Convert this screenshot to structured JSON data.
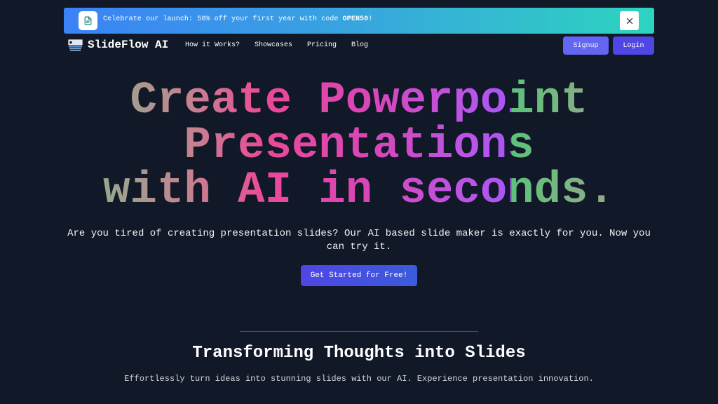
{
  "banner": {
    "text_prefix": "Celebrate our launch: 50% off your first year with code ",
    "code": "OPEN50",
    "text_suffix": "!",
    "icon": "document-icon",
    "close_icon": "close-icon"
  },
  "nav": {
    "brand": "SlideFlow AI",
    "links": [
      "How it Works?",
      "Showcases",
      "Pricing",
      "Blog"
    ],
    "signup": "Signup",
    "login": "Login"
  },
  "hero": {
    "title_line1": "Create Powerpoint",
    "title_line2": "Presentations",
    "title_line3": "with AI in seconds.",
    "subtitle": "Are you tired of creating presentation slides? Our AI based slide maker is exactly for you. Now you can try it.",
    "cta": "Get Started for Free!"
  },
  "section": {
    "title": "Transforming Thoughts into Slides",
    "subtitle": "Effortlessly turn ideas into stunning slides with our AI. Experience presentation innovation."
  },
  "colors": {
    "background": "#111827",
    "accent": "#4f46e5",
    "banner_start": "#3b82f6",
    "banner_end": "#2dd4bf"
  }
}
